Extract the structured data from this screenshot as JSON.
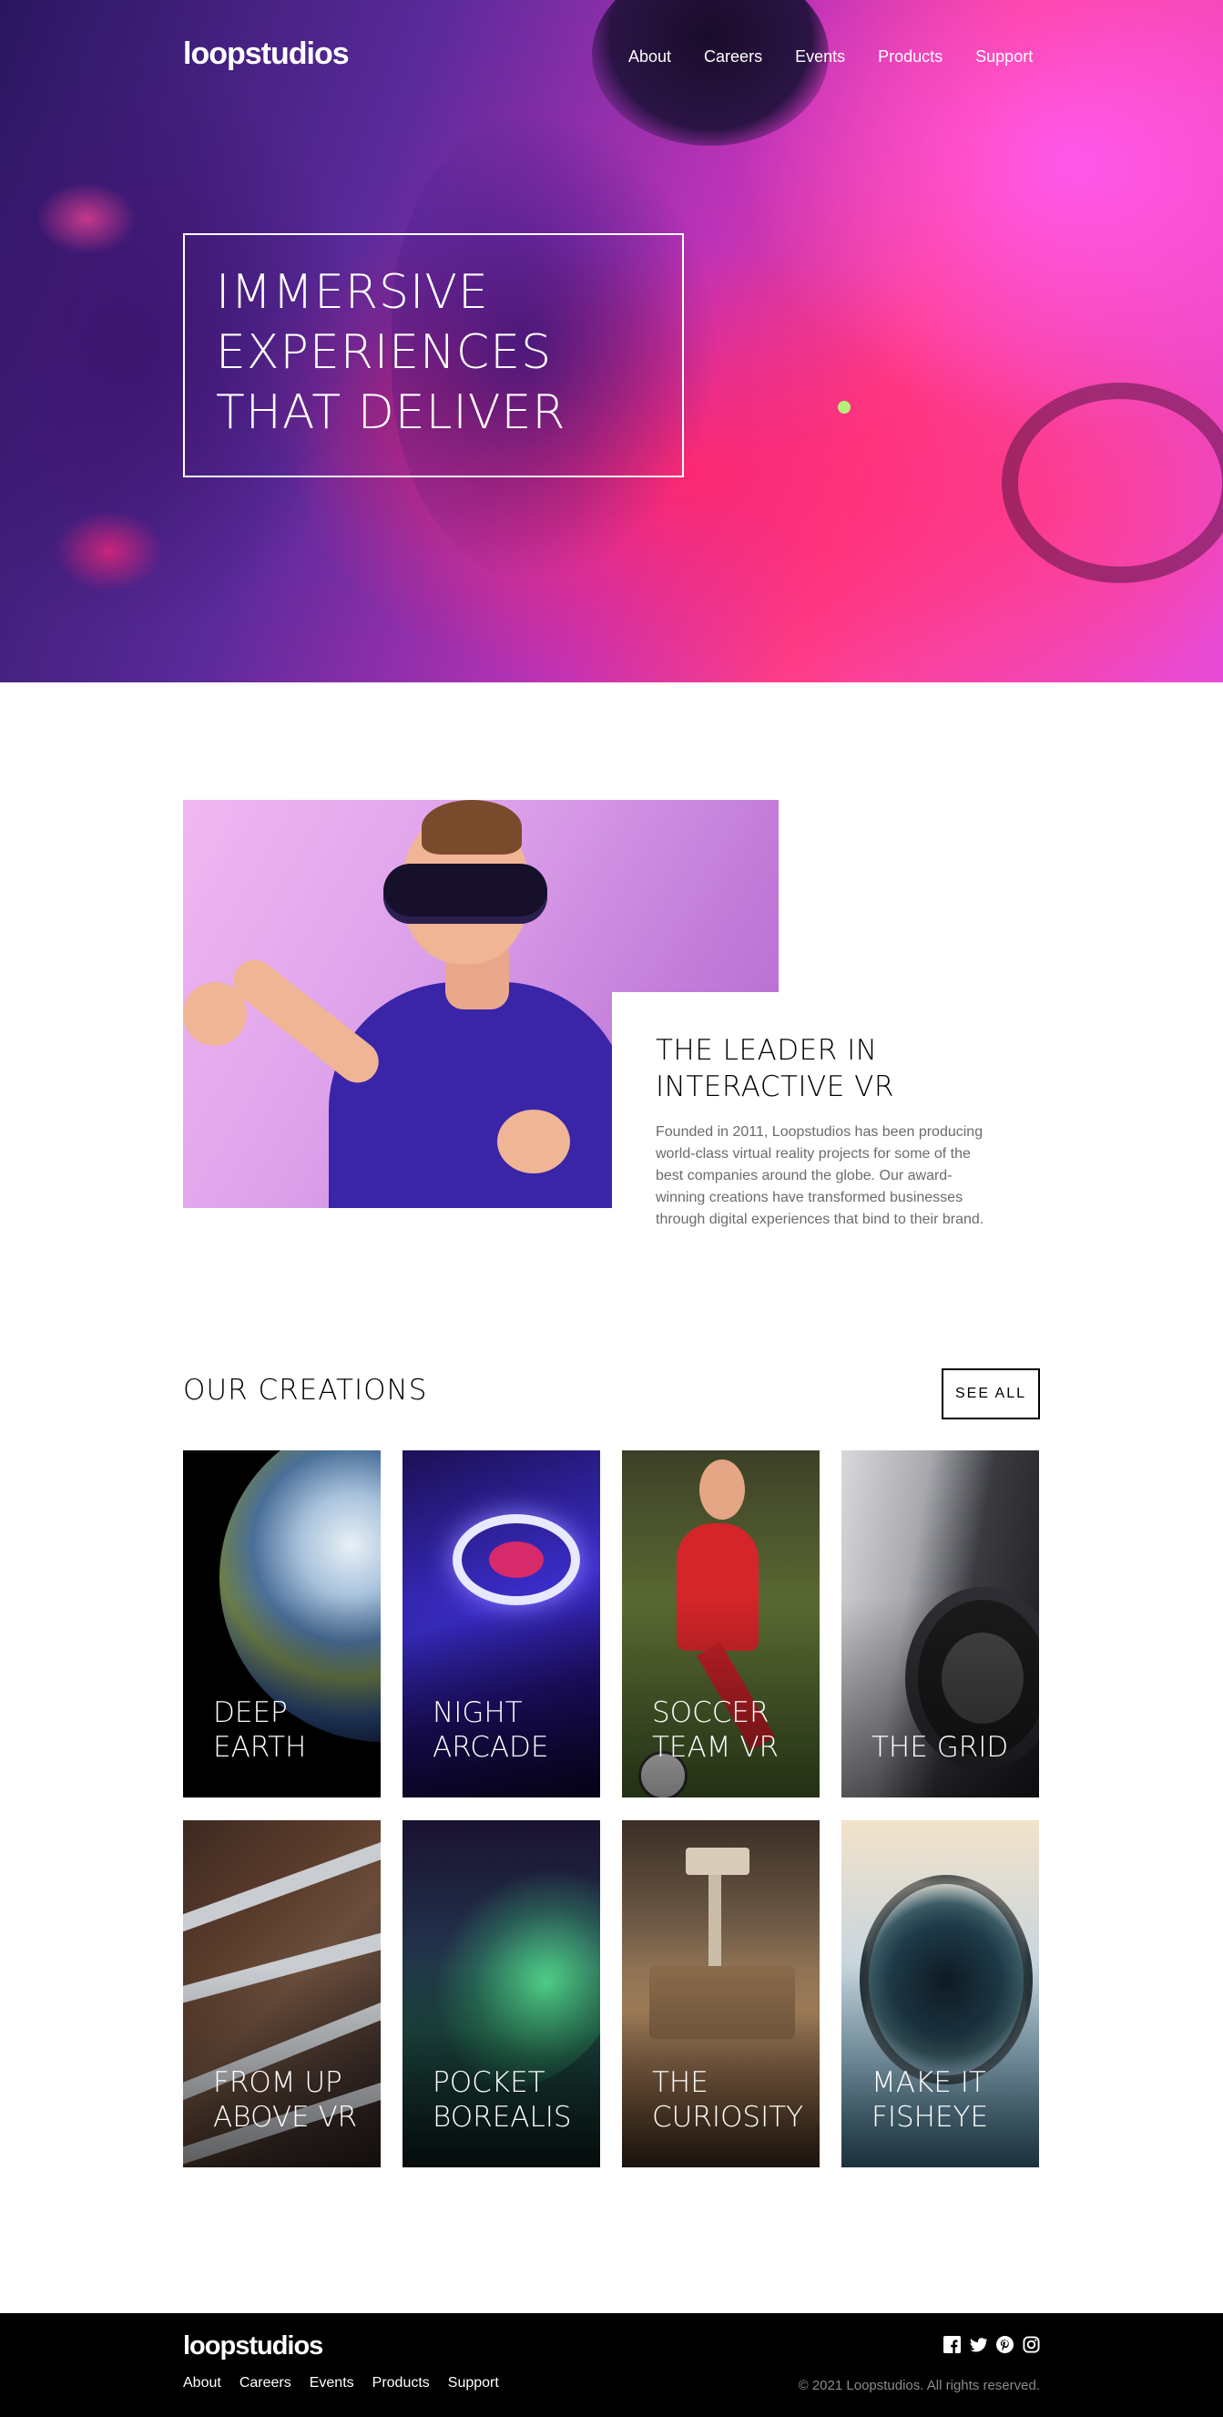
{
  "header": {
    "logo": "loopstudios",
    "nav": [
      "About",
      "Careers",
      "Events",
      "Products",
      "Support"
    ],
    "hero_lines": [
      "Immersive",
      "experiences",
      "that deliver"
    ]
  },
  "about": {
    "title_lines": [
      "The leader in",
      "interactive VR"
    ],
    "text": "Founded in 2011, Loopstudios has been producing world-class virtual reality projects for some of the best companies around the globe. Our award-winning creations have transformed businesses through digital experiences that bind to their brand."
  },
  "creations": {
    "title": "Our creations",
    "see_all": "See all",
    "items": [
      {
        "lines": [
          "Deep",
          "earth"
        ]
      },
      {
        "lines": [
          "Night",
          "arcade"
        ]
      },
      {
        "lines": [
          "Soccer",
          "team VR"
        ]
      },
      {
        "lines": [
          "",
          "The grid"
        ]
      },
      {
        "lines": [
          "From up",
          "above VR"
        ]
      },
      {
        "lines": [
          "Pocket",
          "borealis"
        ]
      },
      {
        "lines": [
          "The",
          "curiosity"
        ]
      },
      {
        "lines": [
          "Make it",
          "fisheye"
        ]
      }
    ]
  },
  "footer": {
    "logo": "loopstudios",
    "nav": [
      "About",
      "Careers",
      "Events",
      "Products",
      "Support"
    ],
    "social": [
      "facebook-icon",
      "twitter-icon",
      "pinterest-icon",
      "instagram-icon"
    ],
    "copyright": "© 2021 Loopstudios. All rights reserved."
  }
}
